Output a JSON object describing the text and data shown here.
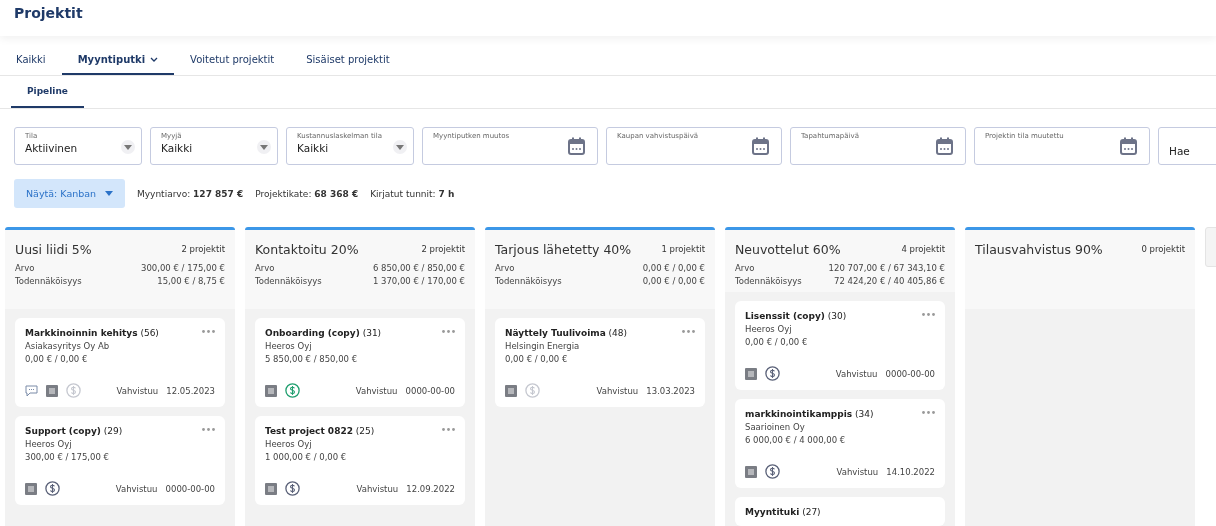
{
  "page_title": "Projektit",
  "tabs": [
    {
      "label": "Kaikki",
      "selected": false,
      "dropdown": false
    },
    {
      "label": "Myyntiputki",
      "selected": true,
      "dropdown": true
    },
    {
      "label": "Voitetut projektit",
      "selected": false,
      "dropdown": false
    },
    {
      "label": "Sisäiset projektit",
      "selected": false,
      "dropdown": false
    }
  ],
  "subtabs": [
    {
      "label": "Pipeline",
      "selected": true
    }
  ],
  "filters": [
    {
      "kind": "select",
      "label": "Tila",
      "value": "Aktiivinen"
    },
    {
      "kind": "select",
      "label": "Myyjä",
      "value": "Kaikki"
    },
    {
      "kind": "select",
      "label": "Kustannuslaskelman tila",
      "value": "Kaikki"
    },
    {
      "kind": "date",
      "label": "Myyntiputken muutos"
    },
    {
      "kind": "date",
      "label": "Kaupan vahvistuspäivä"
    },
    {
      "kind": "date",
      "label": "Tapahtumapäivä"
    },
    {
      "kind": "date",
      "label": "Projektin tila muutettu"
    },
    {
      "kind": "search",
      "placeholder": "Hae"
    }
  ],
  "view_button": "Näytä: Kanban",
  "summary": [
    {
      "label": "Myyntiarvo:",
      "value": "127 857 €"
    },
    {
      "label": "Projektikate:",
      "value": "68 368 €"
    },
    {
      "label": "Kirjatut tunnit:",
      "value": "7 h"
    }
  ],
  "columns": [
    {
      "title": "Uusi liidi 5%",
      "count": "2 projektit",
      "rows": [
        {
          "label": "Arvo",
          "value": "300,00 € / 175,00 €"
        },
        {
          "label": "Todennäköisyys",
          "value": "15,00 € / 8,75 €"
        }
      ],
      "cards": [
        {
          "name": "Markkinoinnin kehitys",
          "number": "(56)",
          "customer": "Asiakasyritys Oy Ab",
          "amount": "0,00 € / 0,00 €",
          "has_comment": true,
          "billing_enabled": false,
          "paid": false,
          "due_label": "Vahvistuu",
          "due": "12.05.2023"
        },
        {
          "name": "Support (copy)",
          "number": "(29)",
          "customer": "Heeros Oyj",
          "amount": "300,00 € / 175,00 €",
          "has_comment": false,
          "billing_enabled": true,
          "paid": false,
          "due_label": "Vahvistuu",
          "due": "0000-00-00"
        }
      ]
    },
    {
      "title": "Kontaktoitu 20%",
      "count": "2 projektit",
      "rows": [
        {
          "label": "Arvo",
          "value": "6 850,00 € / 850,00 €"
        },
        {
          "label": "Todennäköisyys",
          "value": "1 370,00 € / 170,00 €"
        }
      ],
      "cards": [
        {
          "name": "Onboarding (copy)",
          "number": "(31)",
          "customer": "Heeros Oyj",
          "amount": "5 850,00 € / 850,00 €",
          "has_comment": false,
          "billing_enabled": true,
          "paid": true,
          "due_label": "Vahvistuu",
          "due": "0000-00-00"
        },
        {
          "name": "Test project 0822",
          "number": "(25)",
          "customer": "Heeros Oyj",
          "amount": "1 000,00 € / 0,00 €",
          "has_comment": false,
          "billing_enabled": true,
          "paid": false,
          "due_label": "Vahvistuu",
          "due": "12.09.2022"
        }
      ]
    },
    {
      "title": "Tarjous lähetetty 40%",
      "count": "1 projektit",
      "rows": [
        {
          "label": "Arvo",
          "value": "0,00 € / 0,00 €"
        },
        {
          "label": "Todennäköisyys",
          "value": "0,00 € / 0,00 €"
        }
      ],
      "cards": [
        {
          "name": "Näyttely Tuulivoima",
          "number": "(48)",
          "customer": "Helsingin Energia",
          "amount": "0,00 € / 0,00 €",
          "has_comment": false,
          "billing_enabled": false,
          "paid": false,
          "due_label": "Vahvistuu",
          "due": "13.03.2023"
        }
      ]
    },
    {
      "title": "Neuvottelut 60%",
      "count": "4 projektit",
      "rows": [
        {
          "label": "Arvo",
          "value": "120 707,00 € / 67 343,10 €"
        },
        {
          "label": "Todennäköisyys",
          "value": "72 424,20 € / 40 405,86 €"
        }
      ],
      "cards": [
        {
          "name": "Lisenssit (copy)",
          "number": "(30)",
          "customer": "Heeros Oyj",
          "amount": "0,00 € / 0,00 €",
          "has_comment": false,
          "billing_enabled": true,
          "paid": false,
          "due_label": "Vahvistuu",
          "due": "0000-00-00"
        },
        {
          "name": "markkinointikamppis",
          "number": "(34)",
          "customer": "Saarioinen Oy",
          "amount": "6 000,00 € / 4 000,00 €",
          "has_comment": false,
          "billing_enabled": true,
          "paid": false,
          "due_label": "Vahvistuu",
          "due": "14.10.2022"
        },
        {
          "name": "Myyntituki",
          "number": "(27)"
        }
      ]
    },
    {
      "title": "Tilausvahvistus 90%",
      "count": "0 projektit"
    }
  ]
}
